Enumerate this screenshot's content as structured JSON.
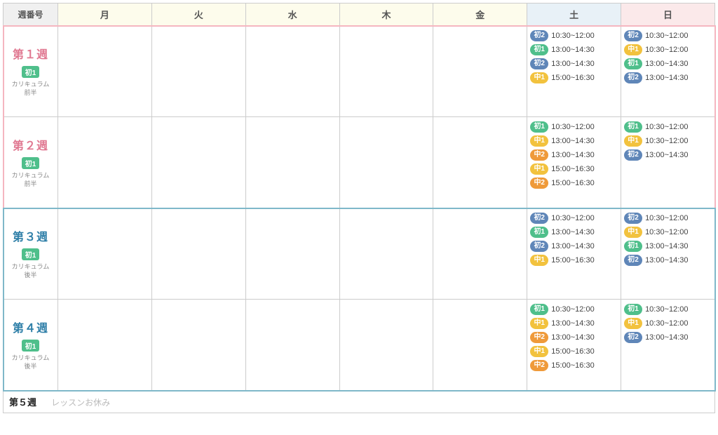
{
  "header": {
    "corner": "週番号",
    "days": [
      "月",
      "火",
      "水",
      "木",
      "金",
      "土",
      "日"
    ]
  },
  "levels": {
    "sho1": "初1",
    "sho2": "初2",
    "chu1": "中1",
    "chu2": "中2"
  },
  "weeks": [
    {
      "id": "w1",
      "title": "第１週",
      "colorClass": "pink",
      "badgeLevel": "sho1",
      "sub1": "カリキュラム",
      "sub2": "前半",
      "sat": [
        {
          "lv": "sho2",
          "time": "10:30~12:00"
        },
        {
          "lv": "sho1",
          "time": "13:00~14:30"
        },
        {
          "lv": "sho2",
          "time": "13:00~14:30"
        },
        {
          "lv": "chu1",
          "time": "15:00~16:30"
        }
      ],
      "sun": [
        {
          "lv": "sho2",
          "time": "10:30~12:00"
        },
        {
          "lv": "chu1",
          "time": "10:30~12:00"
        },
        {
          "lv": "sho1",
          "time": "13:00~14:30"
        },
        {
          "lv": "sho2",
          "time": "13:00~14:30"
        }
      ]
    },
    {
      "id": "w2",
      "title": "第２週",
      "colorClass": "pink",
      "badgeLevel": "sho1",
      "sub1": "カリキュラム",
      "sub2": "前半",
      "sat": [
        {
          "lv": "sho1",
          "time": "10:30~12:00"
        },
        {
          "lv": "chu1",
          "time": "13:00~14:30"
        },
        {
          "lv": "chu2",
          "time": "13:00~14:30"
        },
        {
          "lv": "chu1",
          "time": "15:00~16:30"
        },
        {
          "lv": "chu2",
          "time": "15:00~16:30"
        }
      ],
      "sun": [
        {
          "lv": "sho1",
          "time": "10:30~12:00"
        },
        {
          "lv": "chu1",
          "time": "10:30~12:00"
        },
        {
          "lv": "sho2",
          "time": "13:00~14:30"
        }
      ]
    },
    {
      "id": "w3",
      "title": "第３週",
      "colorClass": "blue",
      "badgeLevel": "sho1",
      "sub1": "カリキュラム",
      "sub2": "後半",
      "sat": [
        {
          "lv": "sho2",
          "time": "10:30~12:00"
        },
        {
          "lv": "sho1",
          "time": "13:00~14:30"
        },
        {
          "lv": "sho2",
          "time": "13:00~14:30"
        },
        {
          "lv": "chu1",
          "time": "15:00~16:30"
        }
      ],
      "sun": [
        {
          "lv": "sho2",
          "time": "10:30~12:00"
        },
        {
          "lv": "chu1",
          "time": "10:30~12:00"
        },
        {
          "lv": "sho1",
          "time": "13:00~14:30"
        },
        {
          "lv": "sho2",
          "time": "13:00~14:30"
        }
      ]
    },
    {
      "id": "w4",
      "title": "第４週",
      "colorClass": "blue",
      "badgeLevel": "sho1",
      "sub1": "カリキュラム",
      "sub2": "後半",
      "sat": [
        {
          "lv": "sho1",
          "time": "10:30~12:00"
        },
        {
          "lv": "chu1",
          "time": "13:00~14:30"
        },
        {
          "lv": "chu2",
          "time": "13:00~14:30"
        },
        {
          "lv": "chu1",
          "time": "15:00~16:30"
        },
        {
          "lv": "chu2",
          "time": "15:00~16:30"
        }
      ],
      "sun": [
        {
          "lv": "sho1",
          "time": "10:30~12:00"
        },
        {
          "lv": "chu1",
          "time": "10:30~12:00"
        },
        {
          "lv": "sho2",
          "time": "13:00~14:30"
        }
      ]
    }
  ],
  "week5": {
    "title": "第５週",
    "note": "レッスンお休み"
  }
}
